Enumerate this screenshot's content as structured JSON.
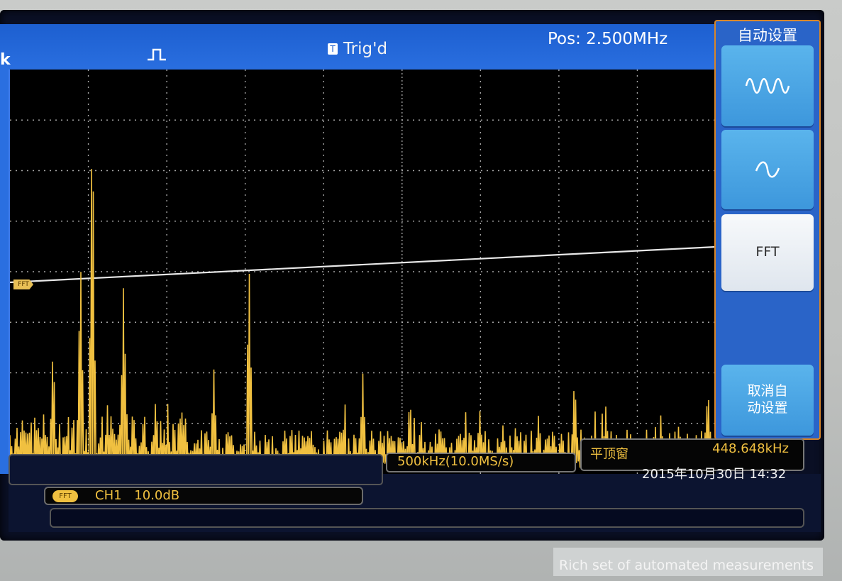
{
  "header": {
    "left_fragment": "k",
    "trigger_status": "Trig'd",
    "position": "Pos: 2.500MHz"
  },
  "menu": {
    "title": "自动设置",
    "buttons": [
      {
        "icon": "multi-cycle-sine-icon",
        "label": ""
      },
      {
        "icon": "single-cycle-sine-icon",
        "label": ""
      },
      {
        "icon": "",
        "label": "FFT"
      },
      {
        "icon": "",
        "label": "取消自\n动设置"
      }
    ]
  },
  "plot": {
    "marker_label": "FFT",
    "trace_color": "#f0c040",
    "grid_color": "#cfcfcf"
  },
  "status": {
    "timebase": "500kHz(10.0MS/s)",
    "window": "平顶窗",
    "cursor_freq": "448.648kHz",
    "datetime": "2015年10月30日 14:32",
    "channel_badge": "FFT",
    "channel": "CH1",
    "scale": "10.0dB"
  },
  "caption": "Rich set of automated measurements",
  "chart_data": {
    "type": "line",
    "title": "",
    "xlabel": "",
    "ylabel": "",
    "spectrum_peaks": [
      {
        "division": 1.05,
        "level": 7.4
      },
      {
        "division": 0.9,
        "level": 4.3
      },
      {
        "division": 1.45,
        "level": 3.8
      },
      {
        "division": 0.55,
        "level": 2.5
      },
      {
        "division": 3.05,
        "level": 4.1
      },
      {
        "division": 2.6,
        "level": 2.0
      },
      {
        "division": 2.2,
        "level": 1.3
      },
      {
        "division": 4.5,
        "level": 1.9
      },
      {
        "division": 7.2,
        "level": 1.9
      },
      {
        "division": 8.9,
        "level": 1.7
      },
      {
        "division": 7.6,
        "level": 1.3
      },
      {
        "division": 5.1,
        "level": 1.5
      }
    ]
  }
}
